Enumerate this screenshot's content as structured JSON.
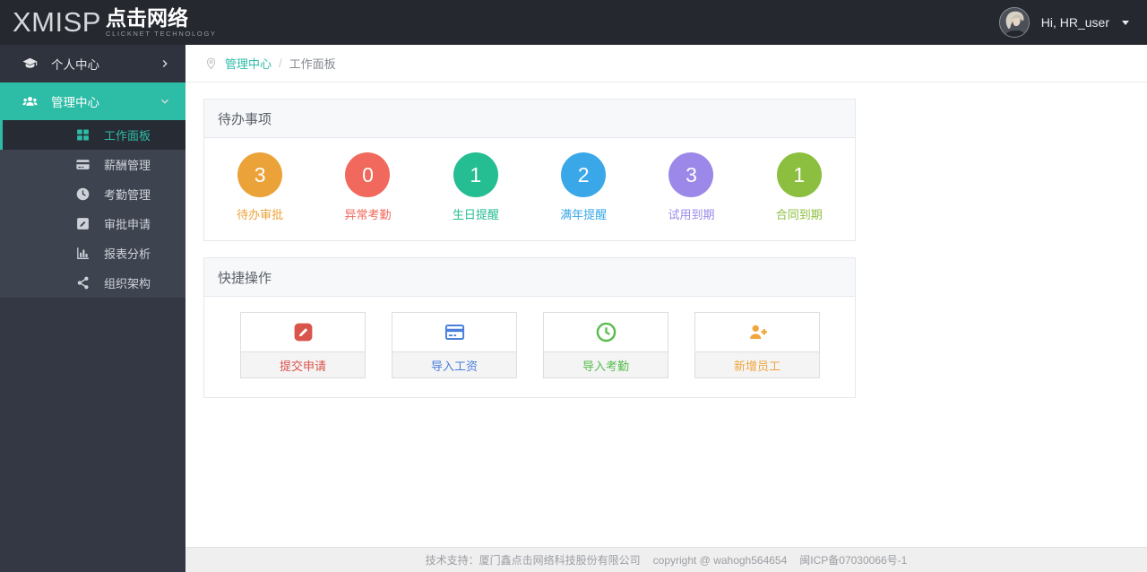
{
  "brand": {
    "logo_en": "XMISP",
    "logo_cn": "点击网络",
    "logo_sub": "CLICKNET TECHNOLOGY"
  },
  "header": {
    "greeting": "Hi, HR_user",
    "avatar_icon": "user-avatar-photo",
    "caret_icon": "caret-down-icon"
  },
  "sidebar": {
    "items": [
      {
        "label": "个人中心",
        "icon": "graduation-cap-icon",
        "chevron": "chevron-right-icon"
      },
      {
        "label": "管理中心",
        "icon": "users-group-icon",
        "chevron": "chevron-down-icon"
      }
    ],
    "subitems": [
      {
        "label": "工作面板",
        "icon": "grid-icon",
        "active": true
      },
      {
        "label": "薪酬管理",
        "icon": "credit-card-icon"
      },
      {
        "label": "考勤管理",
        "icon": "clock-icon"
      },
      {
        "label": "审批申请",
        "icon": "pencil-square-icon"
      },
      {
        "label": "报表分析",
        "icon": "bar-chart-icon"
      },
      {
        "label": "组织架构",
        "icon": "org-nodes-icon"
      }
    ],
    "accent_color": "#2dbca6"
  },
  "breadcrumb": {
    "pin_icon": "map-pin-icon",
    "section": "管理中心",
    "separator": "/",
    "page": "工作面板"
  },
  "todo_panel": {
    "title": "待办事项",
    "items": [
      {
        "count": "3",
        "label": "待办审批",
        "color": "#eba239"
      },
      {
        "count": "0",
        "label": "异常考勤",
        "color": "#f0695c"
      },
      {
        "count": "1",
        "label": "生日提醒",
        "color": "#25bd92"
      },
      {
        "count": "2",
        "label": "满年提醒",
        "color": "#3aa8e8"
      },
      {
        "count": "3",
        "label": "试用到期",
        "color": "#9b88e8"
      },
      {
        "count": "1",
        "label": "合同到期",
        "color": "#8cbf40"
      }
    ]
  },
  "quick_panel": {
    "title": "快捷操作",
    "actions": [
      {
        "label": "提交申请",
        "icon": "pencil-badge-icon",
        "color": "#d9544a"
      },
      {
        "label": "导入工资",
        "icon": "credit-card-outline-icon",
        "color": "#4a7fdb"
      },
      {
        "label": "导入考勤",
        "icon": "clock-outline-icon",
        "color": "#58bd4c"
      },
      {
        "label": "新增员工",
        "icon": "user-plus-icon",
        "color": "#f0a63c"
      }
    ]
  },
  "footer": {
    "support": "技术支持：厦门鑫点击网络科技股份有限公司",
    "copyright": "copyright @ wahogh564654",
    "icp": "闽ICP备07030066号-1"
  }
}
